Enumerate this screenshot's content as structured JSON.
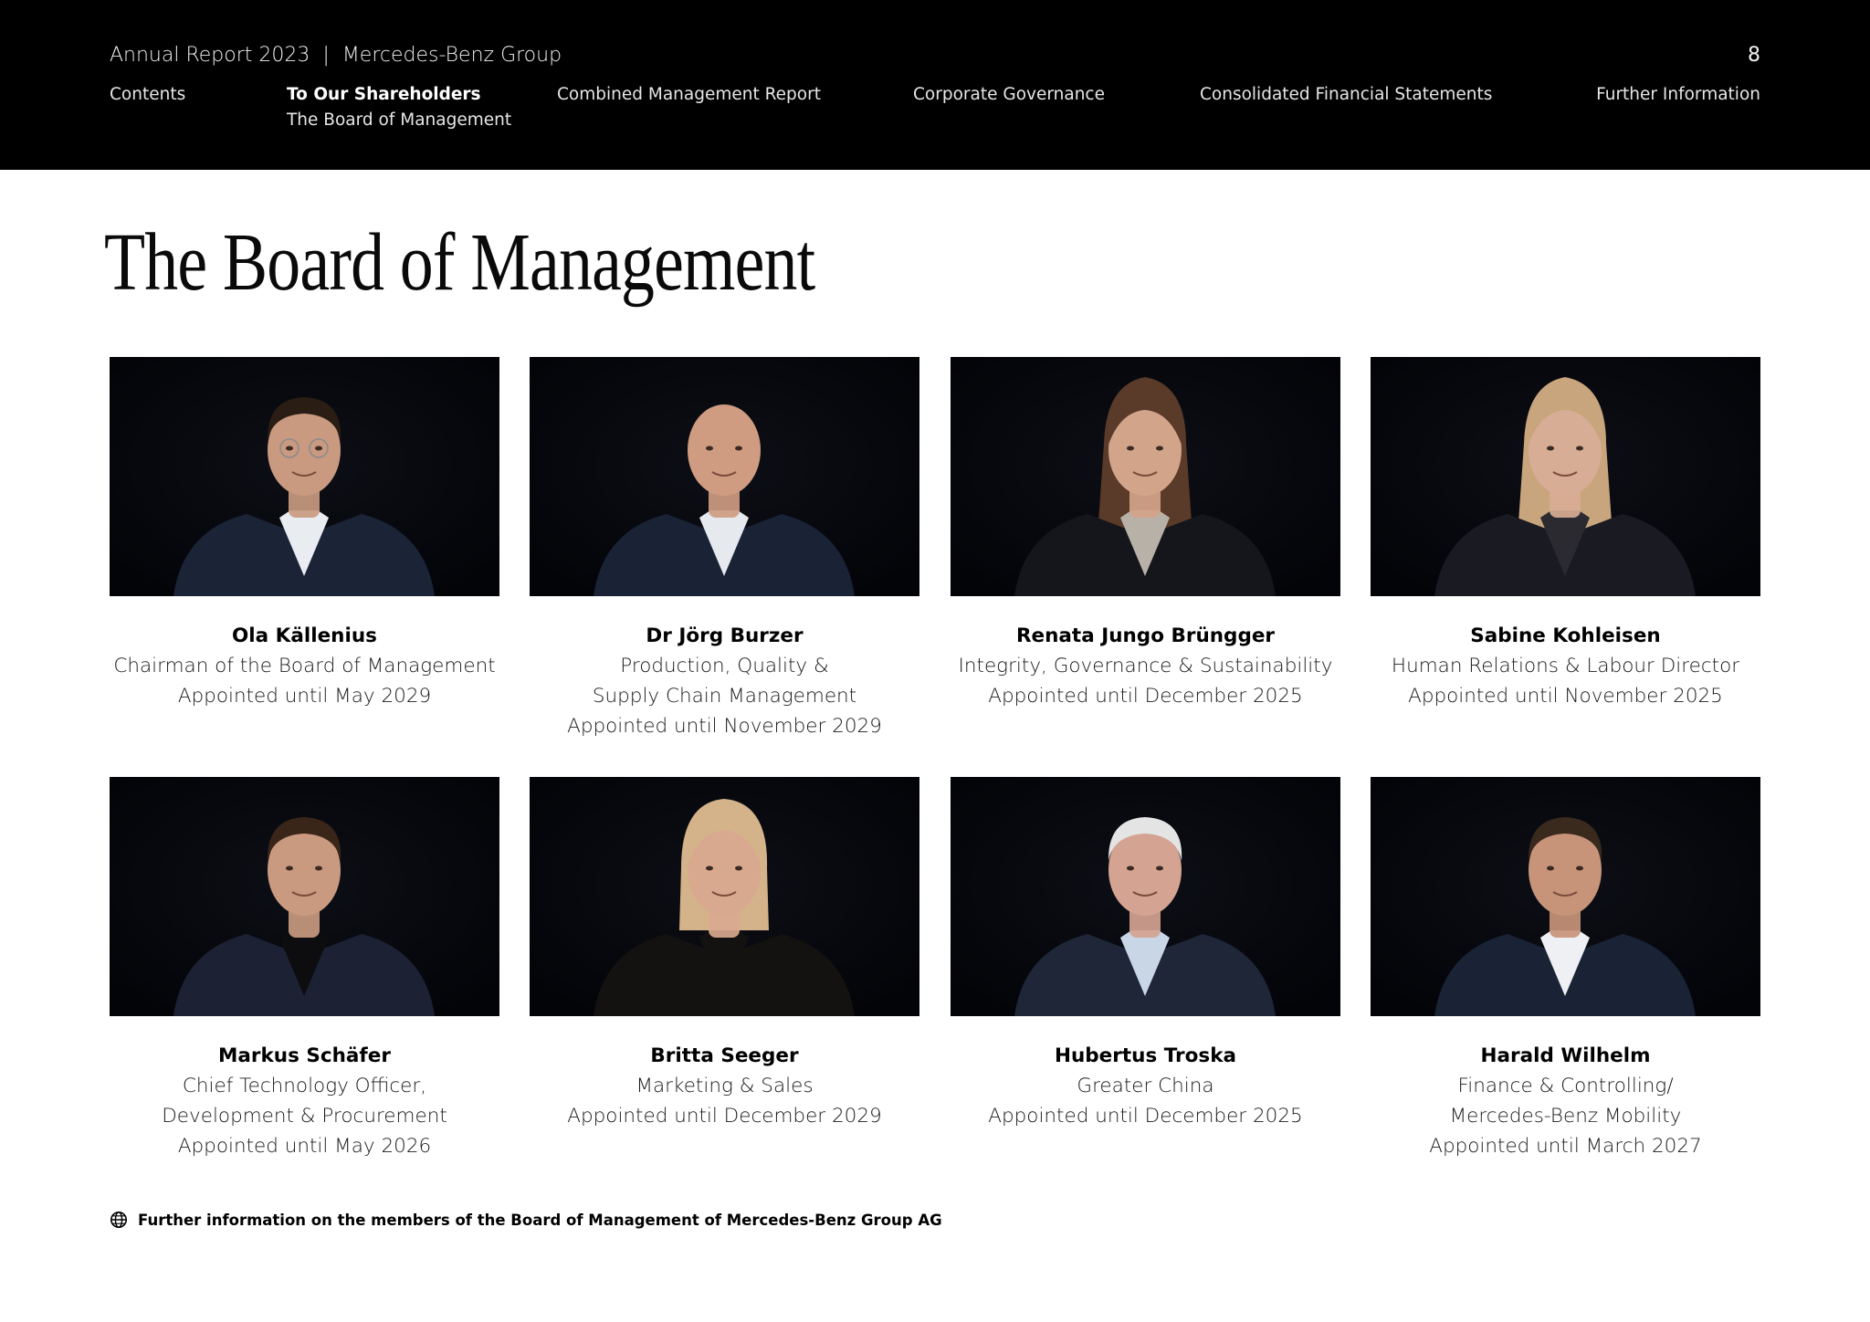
{
  "header": {
    "report_title": "Annual Report 2023",
    "separator": "|",
    "company": "Mercedes-Benz Group",
    "page_number": "8",
    "nav": [
      {
        "label": "Contents"
      },
      {
        "label": "To Our Shareholders",
        "sub": "The Board of Management",
        "active": true
      },
      {
        "label": "Combined Management Report"
      },
      {
        "label": "Corporate Governance"
      },
      {
        "label": "Consolidated Financial Statements"
      },
      {
        "label": "Further Information"
      }
    ]
  },
  "page_title": "The Board of Management",
  "members": [
    {
      "name": "Ola Källenius",
      "lines": [
        "Chairman of the Board of Management",
        "Appointed until May 2029"
      ],
      "suit": "#1b2436",
      "shirt": "#e9edf2",
      "hair": "#2a1d14",
      "skin": "#c99a80",
      "glasses": true
    },
    {
      "name": "Dr Jörg Burzer",
      "lines": [
        "Production, Quality &",
        "Supply Chain Management",
        "Appointed until November 2029"
      ],
      "suit": "#1a2236",
      "shirt": "#e6eaef",
      "hair": "#c48f73",
      "skin": "#cf9c82",
      "bald": true
    },
    {
      "name": "Renata Jungo Brüngger",
      "lines": [
        "Integrity, Governance & Sustainability",
        "Appointed until December 2025"
      ],
      "suit": "#15161c",
      "shirt": "#b7b1a8",
      "hair": "#5a3a28",
      "skin": "#d2a48a",
      "long_hair": true
    },
    {
      "name": "Sabine Kohleisen",
      "lines": [
        "Human Relations & Labour Director",
        "Appointed until November 2025"
      ],
      "suit": "#1a1b22",
      "shirt": "#2a2a30",
      "hair": "#c8a57c",
      "skin": "#d8ad95",
      "long_hair": true
    },
    {
      "name": "Markus Schäfer",
      "lines": [
        "Chief Technology Officer,",
        "Development & Procurement",
        "Appointed until May 2026"
      ],
      "suit": "#1c2233",
      "shirt": "#0d0d0f",
      "hair": "#3a2618",
      "skin": "#c99a80"
    },
    {
      "name": "Britta Seeger",
      "lines": [
        "Marketing & Sales",
        "Appointed until December 2029"
      ],
      "suit": "#141210",
      "shirt": "#141210",
      "hair": "#d4b38a",
      "skin": "#d9a98f",
      "bob_hair": true
    },
    {
      "name": "Hubertus Troska",
      "lines": [
        "Greater China",
        "Appointed until December 2025"
      ],
      "suit": "#1e2638",
      "shirt": "#c8d6e6",
      "hair": "#e4e4e4",
      "skin": "#d4a391"
    },
    {
      "name": "Harald Wilhelm",
      "lines": [
        "Finance & Controlling/",
        "Mercedes-Benz Mobility",
        "Appointed until March 2027"
      ],
      "suit": "#1a2236",
      "shirt": "#eef0f3",
      "hair": "#3a2a1e",
      "skin": "#c89479"
    }
  ],
  "footer": {
    "icon": "globe-icon",
    "link_text": "Further information on the members of the Board of Management of Mercedes-Benz Group AG"
  }
}
